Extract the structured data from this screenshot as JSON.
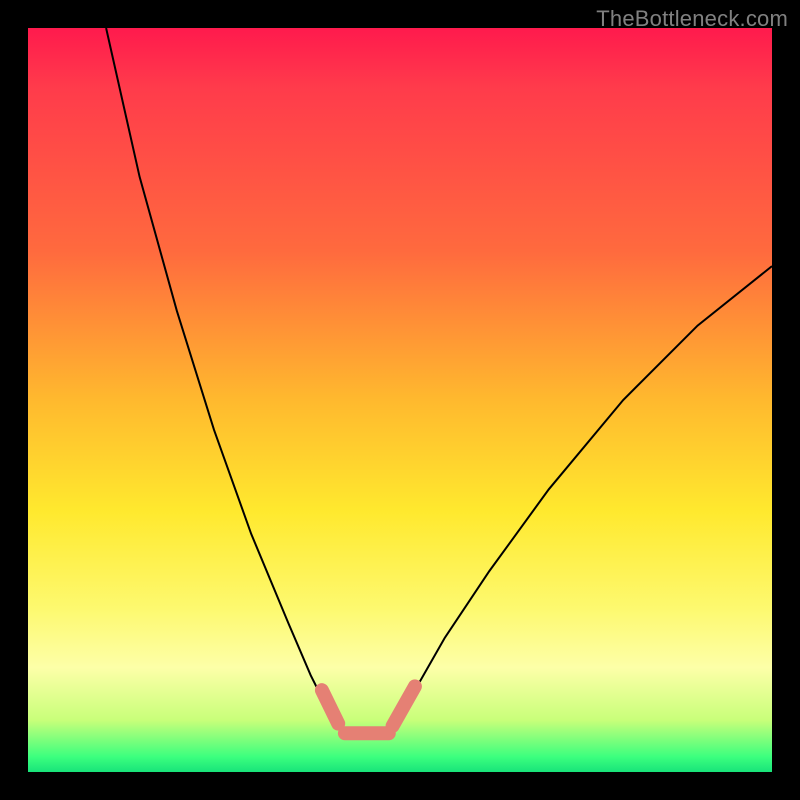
{
  "watermark": "TheBottleneck.com",
  "colors": {
    "frame": "#000000",
    "gradient_top": "#ff1a4d",
    "gradient_bottom": "#18e37a",
    "curve": "#000000",
    "marker": "#e58074"
  },
  "chart_data": {
    "type": "line",
    "title": "",
    "xlabel": "",
    "ylabel": "",
    "xlim": [
      0,
      100
    ],
    "ylim": [
      0,
      100
    ],
    "series": [
      {
        "name": "left-branch",
        "x": [
          10.5,
          15,
          20,
          25,
          30,
          35,
          38,
          40,
          41.8
        ],
        "values": [
          100,
          80,
          62,
          46,
          32,
          20,
          13,
          9,
          6.5
        ]
      },
      {
        "name": "right-branch",
        "x": [
          49.3,
          52,
          56,
          62,
          70,
          80,
          90,
          100
        ],
        "values": [
          6.5,
          11,
          18,
          27,
          38,
          50,
          60,
          68
        ]
      },
      {
        "name": "bottom-flat",
        "x": [
          42.6,
          45,
          47.5
        ],
        "values": [
          5.2,
          5.1,
          5.3
        ]
      }
    ],
    "markers": [
      {
        "name": "left-tail",
        "x": [
          39.5,
          41.7
        ],
        "values": [
          11,
          6.5
        ]
      },
      {
        "name": "bottom",
        "x": [
          42.6,
          48.5
        ],
        "values": [
          5.2,
          5.2
        ]
      },
      {
        "name": "right-tail",
        "x": [
          49.0,
          52.0
        ],
        "values": [
          6.2,
          11.5
        ]
      }
    ]
  }
}
